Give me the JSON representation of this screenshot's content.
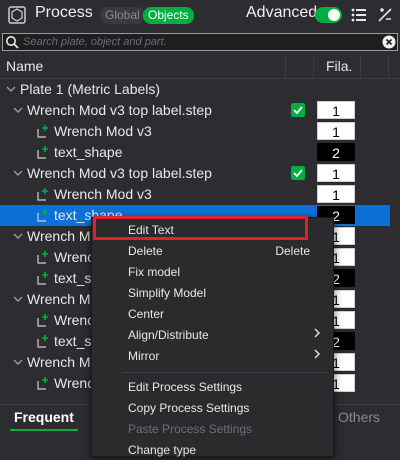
{
  "header": {
    "title": "Process",
    "mode_global": "Global",
    "mode_objects": "Objects",
    "advanced_label": "Advanced",
    "advanced_on": true,
    "title_icon": "process-icon",
    "list_icon": "list-icon",
    "split_icon": "split-icon"
  },
  "search": {
    "placeholder": "Search plate, object and part.",
    "value": ""
  },
  "columns": {
    "name": "Name",
    "fila": "Fila."
  },
  "tree": {
    "plate_label": "Plate 1 (Metric Labels)",
    "rows": [
      {
        "label": "Wrench Mod v3 top label.step",
        "type": "object",
        "checked": true,
        "fila": "1",
        "fila_style": "white"
      },
      {
        "label": "Wrench Mod v3",
        "type": "part",
        "fila": "1",
        "fila_style": "white"
      },
      {
        "label": "text_shape",
        "type": "part",
        "fila": "2",
        "fila_style": "black"
      },
      {
        "label": "Wrench Mod v3 top label.step",
        "type": "object",
        "checked": true,
        "fila": "1",
        "fila_style": "white"
      },
      {
        "label": "Wrench Mod v3",
        "type": "part",
        "fila": "1",
        "fila_style": "white"
      },
      {
        "label": "text_shape",
        "type": "part",
        "fila": "2",
        "fila_style": "black",
        "selected": true
      },
      {
        "label": "Wrench Mod v3 top label.step",
        "type": "object",
        "fila": "1",
        "fila_style": "white"
      },
      {
        "label": "Wrench Mod v3",
        "type": "part",
        "fila": "1",
        "fila_style": "white"
      },
      {
        "label": "text_shape",
        "type": "part",
        "fila": "2",
        "fila_style": "black"
      },
      {
        "label": "Wrench Mod v3 top label.step",
        "type": "object",
        "fila": "1",
        "fila_style": "white"
      },
      {
        "label": "Wrench Mod v3",
        "type": "part",
        "fila": "1",
        "fila_style": "white"
      },
      {
        "label": "text_shape",
        "type": "part",
        "fila": "2",
        "fila_style": "black"
      },
      {
        "label": "Wrench Mod v3 top label.step",
        "type": "object",
        "fila": "1",
        "fila_style": "white"
      },
      {
        "label": "Wrench Mod v3",
        "type": "part",
        "fila": "1",
        "fila_style": "white"
      }
    ]
  },
  "tabs": {
    "frequent": "Frequent",
    "others": "Others"
  },
  "context_menu": {
    "items": [
      {
        "label": "Edit Text",
        "shortcut": "",
        "submenu": false,
        "disabled": false,
        "highlighted": true
      },
      {
        "label": "Delete",
        "shortcut": "Delete",
        "submenu": false,
        "disabled": false
      },
      {
        "label": "Fix model",
        "shortcut": "",
        "submenu": false,
        "disabled": false
      },
      {
        "label": "Simplify Model",
        "shortcut": "",
        "submenu": false,
        "disabled": false
      },
      {
        "label": "Center",
        "shortcut": "",
        "submenu": false,
        "disabled": false
      },
      {
        "label": "Align/Distribute",
        "shortcut": "",
        "submenu": true,
        "disabled": false
      },
      {
        "label": "Mirror",
        "shortcut": "",
        "submenu": true,
        "disabled": false
      },
      {
        "label": "Edit Process Settings",
        "shortcut": "",
        "submenu": false,
        "disabled": false
      },
      {
        "label": "Copy Process Settings",
        "shortcut": "",
        "submenu": false,
        "disabled": false
      },
      {
        "label": "Paste Process Settings",
        "shortcut": "",
        "submenu": false,
        "disabled": true
      },
      {
        "label": "Change type",
        "shortcut": "",
        "submenu": false,
        "disabled": false
      }
    ]
  },
  "colors": {
    "accent_green": "#00ae42",
    "selection_blue": "#0b71d6",
    "highlight_red": "#e2202c"
  }
}
